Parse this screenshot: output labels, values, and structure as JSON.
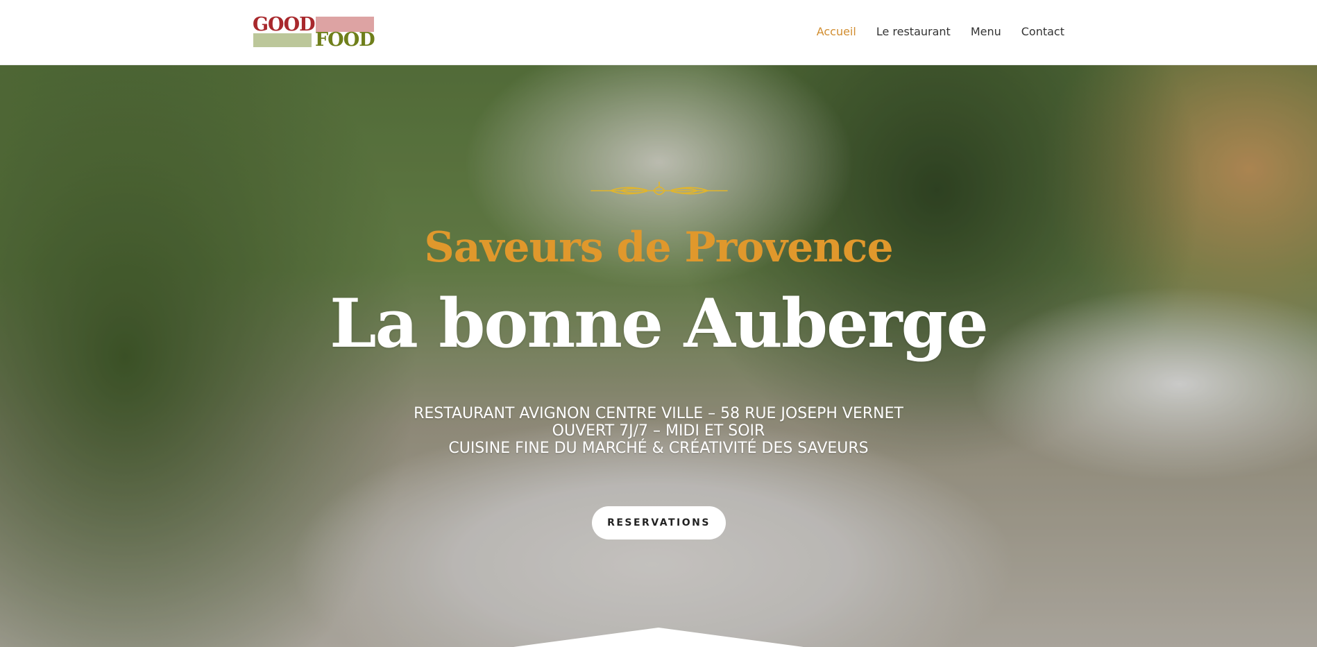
{
  "header": {
    "logo": {
      "word_top": "GOOD",
      "word_bottom": "FOOD",
      "colors": {
        "red": "#a8282c",
        "pink": "#dda3a3",
        "green_block": "#bcc79a",
        "olive": "#6f7f1b"
      }
    },
    "nav": [
      {
        "label": "Accueil",
        "active": true
      },
      {
        "label": "Le restaurant",
        "active": false
      },
      {
        "label": "Menu",
        "active": false
      },
      {
        "label": "Contact",
        "active": false
      }
    ],
    "accent_color": "#d18d2f"
  },
  "hero": {
    "ornament": "wheat-ornament-icon",
    "tagline": "Saveurs de Provence",
    "title": "La bonne Auberge",
    "info_lines": [
      "RESTAURANT AVIGNON CENTRE VILLE – 58 RUE JOSEPH VERNET",
      "OUVERT 7J/7 – MIDI ET SOIR",
      "CUISINE FINE DU MARCHÉ & CRÉATIVITÉ DES SAVEURS"
    ],
    "button_label": "RESERVATIONS",
    "tagline_color": "#e0982c"
  }
}
